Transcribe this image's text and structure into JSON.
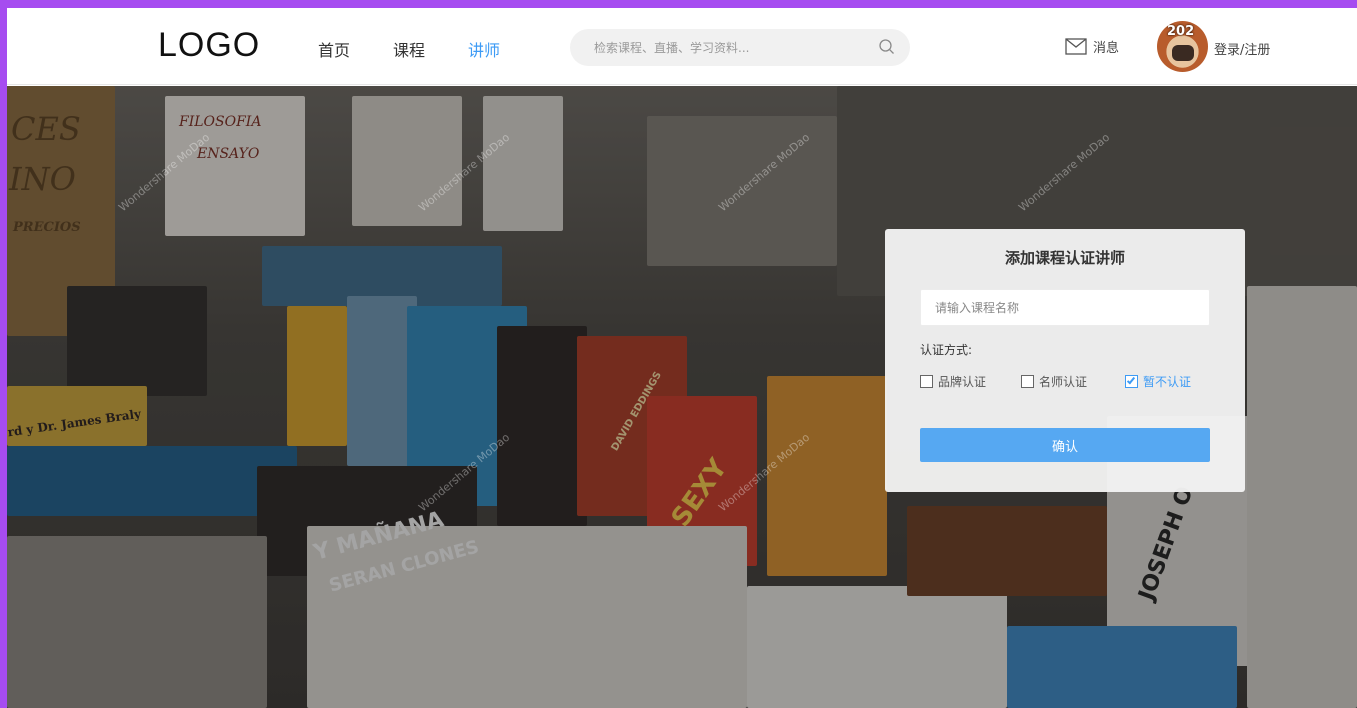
{
  "header": {
    "logo": "LOGO",
    "nav": [
      {
        "label": "首页",
        "active": false
      },
      {
        "label": "课程",
        "active": false
      },
      {
        "label": "讲师",
        "active": true
      }
    ],
    "search": {
      "placeholder": "检索课程、直播、学习资料...",
      "icon": "search-icon"
    },
    "messages": {
      "label": "消息",
      "icon": "mail-icon"
    },
    "avatar": {
      "badge": "202"
    },
    "login": "登录/注册"
  },
  "hero": {
    "sign_lines": [
      "CES",
      "INO",
      "PRECIOS"
    ],
    "placard_lines": [
      "FILOSOFIA",
      "ENSAYO"
    ],
    "book_titles": [
      "rd y Dr. James Braly",
      "Y MAÑANA",
      "SERAN CLONES",
      "SEXY",
      "DAVID EDDINGS",
      "JOSEPH O"
    ],
    "watermark": "Wondershare MoDao"
  },
  "card": {
    "title": "添加课程认证讲师",
    "input_placeholder": "请输入课程名称",
    "method_label": "认证方式:",
    "options": [
      {
        "label": "品牌认证",
        "checked": false
      },
      {
        "label": "名师认证",
        "checked": false
      },
      {
        "label": "暂不认证",
        "checked": true
      }
    ],
    "confirm_label": "确认"
  },
  "colors": {
    "accent": "#3d9bf5",
    "button": "#56a8f2",
    "outer_border": "#a64cf0"
  }
}
